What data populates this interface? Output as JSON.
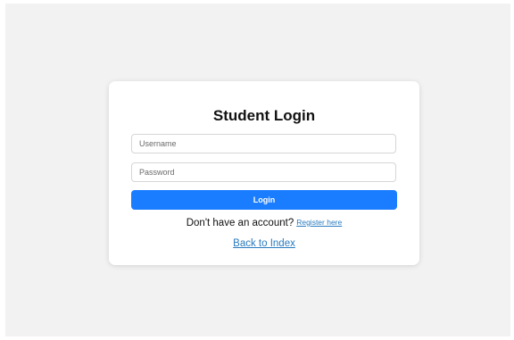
{
  "login_form": {
    "title": "Student Login",
    "username_placeholder": "Username",
    "password_placeholder": "Password",
    "login_label": "Login",
    "register_prompt": "Don't have an account?",
    "register_link": "Register here",
    "back_link": "Back to Index"
  },
  "colors": {
    "page_background": "#f2f2f2",
    "card_background": "#ffffff",
    "primary_button": "#1a7cff",
    "link": "#2a7bbf"
  }
}
